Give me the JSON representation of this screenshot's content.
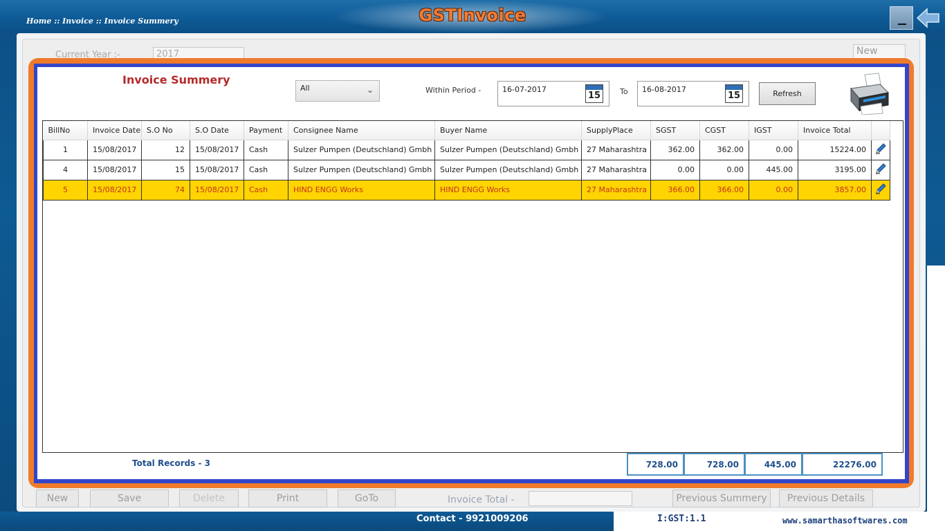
{
  "header": {
    "breadcrumb": "Home :: Invoice :: Invoice Summery",
    "app_title": "GSTInvoice",
    "minimize_icon": "minimize-icon",
    "back_icon": "back-arrow-icon"
  },
  "background_form": {
    "year_label": "Current Year :-",
    "year_value": "2017",
    "new_value": "New",
    "buttons": [
      "New",
      "Save",
      "Delete",
      "Print",
      "GoTo"
    ],
    "invoice_total_label": "Invoice Total -",
    "nav_buttons": [
      "Previous Summery",
      "Previous Details"
    ]
  },
  "footer": {
    "contact": "Contact - 9921009206",
    "version": "I:GST:1.1",
    "website": "www.samarthasoftwares.com"
  },
  "modal": {
    "title": "Invoice Summery",
    "filter_selected": "All",
    "period_label": "Within Period -",
    "from_date": "16-07-2017",
    "to_label": "To",
    "to_date": "16-08-2017",
    "calendar_day": "15",
    "refresh_label": "Refresh",
    "printer_icon": "printer-icon",
    "colors": {
      "frame_orange": "#ef7b2b",
      "frame_blue": "#3346c9",
      "selected_row": "#ffd400",
      "title_red": "#b52a2a"
    }
  },
  "grid": {
    "columns": [
      "BillNo",
      "Invoice Date",
      "S.O No",
      "S.O Date",
      "Payment",
      "Consignee Name",
      "Buyer Name",
      "SupplyPlace",
      "SGST",
      "CGST",
      "IGST",
      "Invoice Total"
    ],
    "rows": [
      {
        "billno": "1",
        "invoice_date": "15/08/2017",
        "so_no": "12",
        "so_date": "15/08/2017",
        "payment": "Cash",
        "consignee": "Sulzer Pumpen (Deutschland) Gmbh",
        "buyer": "Sulzer Pumpen (Deutschland) Gmbh",
        "supply_place": "27 Maharashtra",
        "sgst": "362.00",
        "cgst": "362.00",
        "igst": "0.00",
        "total": "15224.00"
      },
      {
        "billno": "4",
        "invoice_date": "15/08/2017",
        "so_no": "15",
        "so_date": "15/08/2017",
        "payment": "Cash",
        "consignee": "Sulzer Pumpen (Deutschland) Gmbh",
        "buyer": "Sulzer Pumpen (Deutschland) Gmbh",
        "supply_place": "27 Maharashtra",
        "sgst": "0.00",
        "cgst": "0.00",
        "igst": "445.00",
        "total": "3195.00"
      },
      {
        "billno": "5",
        "invoice_date": "15/08/2017",
        "so_no": "74",
        "so_date": "15/08/2017",
        "payment": "Cash",
        "consignee": "HIND ENGG Works",
        "buyer": "HIND ENGG Works",
        "supply_place": "27 Maharashtra",
        "sgst": "366.00",
        "cgst": "366.00",
        "igst": "0.00",
        "total": "3857.00"
      }
    ],
    "edit_icon": "pencil-edit-icon"
  },
  "totals": {
    "records_label": "Total Records - 3",
    "sgst": "728.00",
    "cgst": "728.00",
    "igst": "445.00",
    "grand_total": "22276.00"
  }
}
